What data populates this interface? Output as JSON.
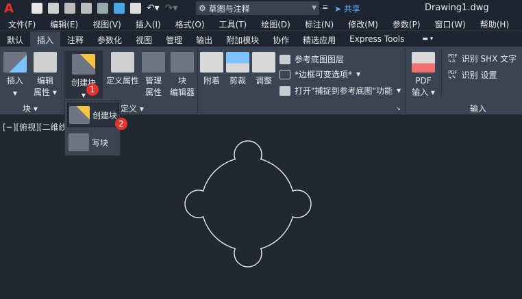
{
  "titlebar": {
    "workspace": "草图与注释",
    "share": "共享",
    "document": "Drawing1.dwg"
  },
  "menu": [
    "文件(F)",
    "编辑(E)",
    "视图(V)",
    "插入(I)",
    "格式(O)",
    "工具(T)",
    "绘图(D)",
    "标注(N)",
    "修改(M)",
    "参数(P)",
    "窗口(W)",
    "帮助(H)"
  ],
  "tabs": [
    "默认",
    "插入",
    "注释",
    "参数化",
    "视图",
    "管理",
    "输出",
    "附加模块",
    "协作",
    "精选应用",
    "Express Tools"
  ],
  "ribbon": {
    "block": {
      "insert": "插入",
      "edit_attr_1": "编辑",
      "edit_attr_2": "属性",
      "label": "块"
    },
    "blockdef": {
      "create": "创建块",
      "define_attr": "定义属性",
      "manage_1": "管理",
      "manage_2": "属性",
      "editor_1": "块",
      "editor_2": "编辑器",
      "label": "定义"
    },
    "reference": {
      "attach": "附着",
      "clip": "剪裁",
      "adjust": "调整",
      "underlay_layers": "参考底图图层",
      "frame": "*边框可变选项*",
      "snap": "打开\"捕捉到参考底图\"功能"
    },
    "import": {
      "pdf_1": "PDF",
      "pdf_2": "输入",
      "shx": "识别 SHX 文字",
      "settings": "识别 设置",
      "label": "输入"
    }
  },
  "dropdown": {
    "create": "创建块",
    "write": "写块"
  },
  "badges": [
    "1",
    "2"
  ],
  "viewport": "[−][俯视][二维线",
  "colors": {
    "accent": "#5ab2ff",
    "badge": "#e5322d",
    "canvas": "#212830"
  }
}
